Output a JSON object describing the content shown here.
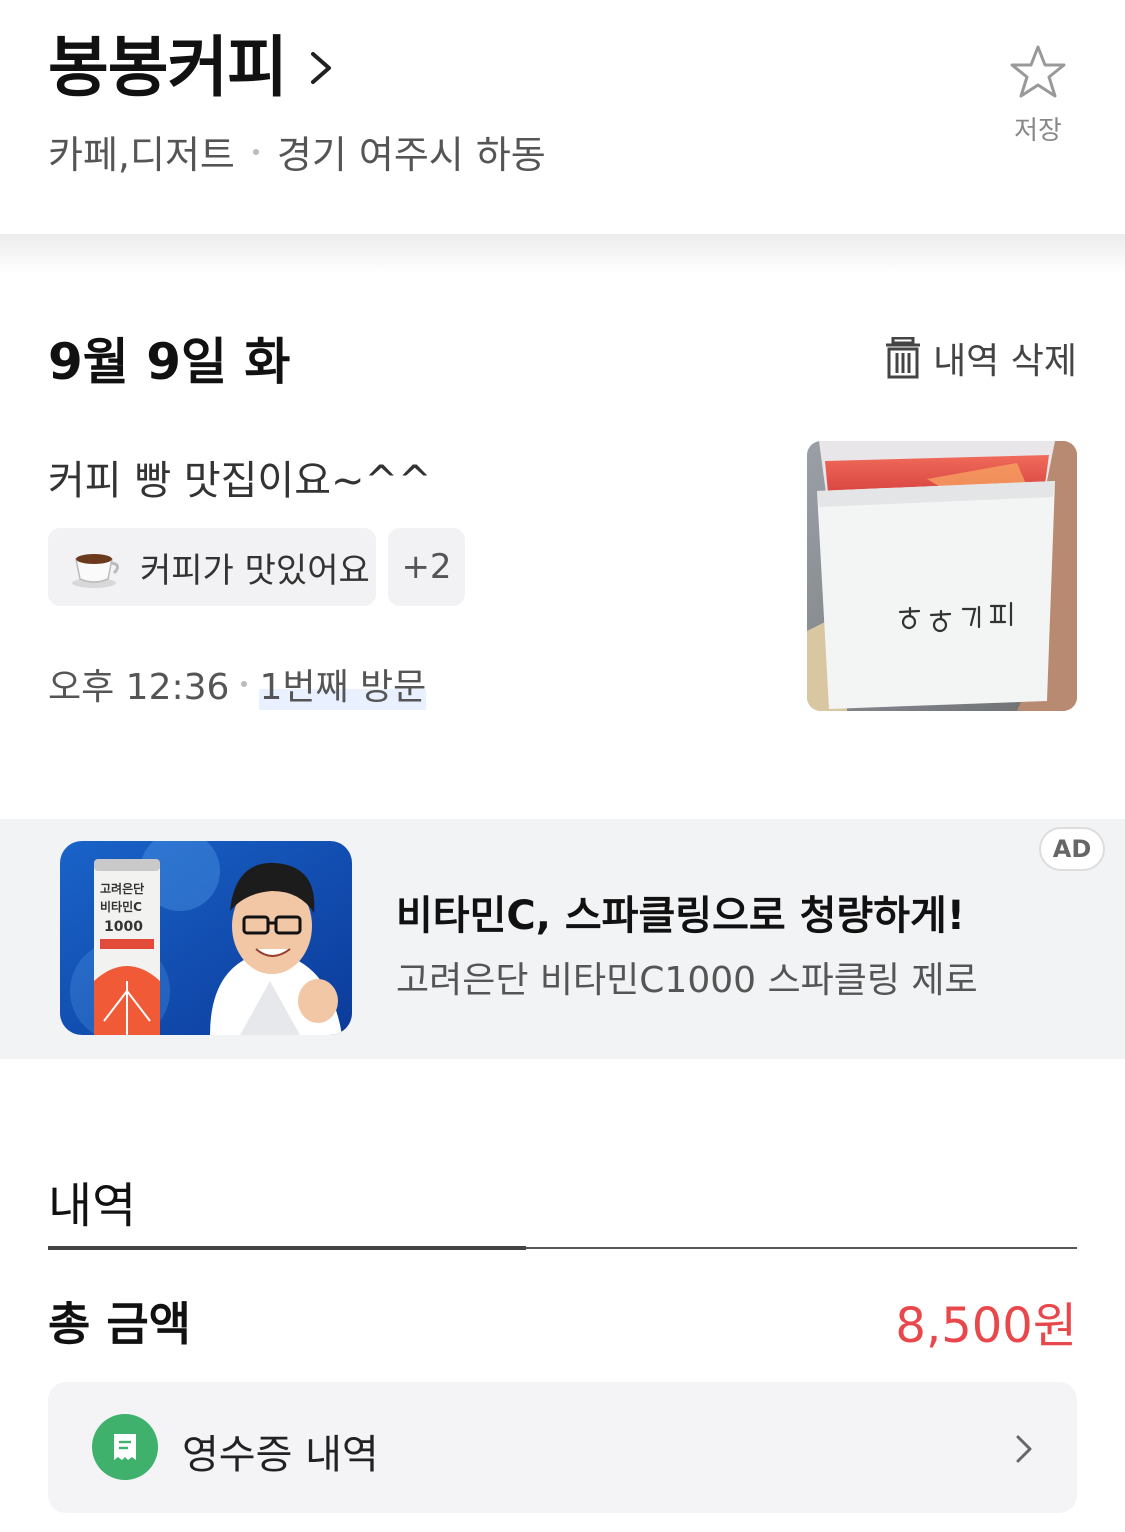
{
  "store": {
    "name": "봉봉커피",
    "category": "카페,디저트",
    "location": "경기 여주시 하동",
    "save_label": "저장"
  },
  "visit": {
    "date": "9월 9일 화",
    "delete_label": "내역 삭제",
    "review_text": "커피 빵 맛집이요~^^",
    "tags": [
      {
        "label": "커피가 맛있어요",
        "icon": "coffee-cup-icon"
      },
      {
        "label": "+2"
      }
    ],
    "time": "오후 12:36",
    "visit_count": "1번째 방문",
    "photo_caption": "봉봉커피"
  },
  "ad": {
    "title": "비타민C, 스파클링으로 청량하게!",
    "subtitle": "고려은단 비타민C1000 스파클링 제로",
    "badge": "AD",
    "can_label_line1": "고려은단",
    "can_label_line2": "비타민C",
    "can_label_line3": "1000"
  },
  "details": {
    "section_title": "내역",
    "total_label": "총 금액",
    "total_value": "8,500원",
    "receipt_label": "영수증 내역"
  },
  "colors": {
    "accent_price": "#e8484c",
    "receipt_icon_bg": "#3fb16d"
  }
}
